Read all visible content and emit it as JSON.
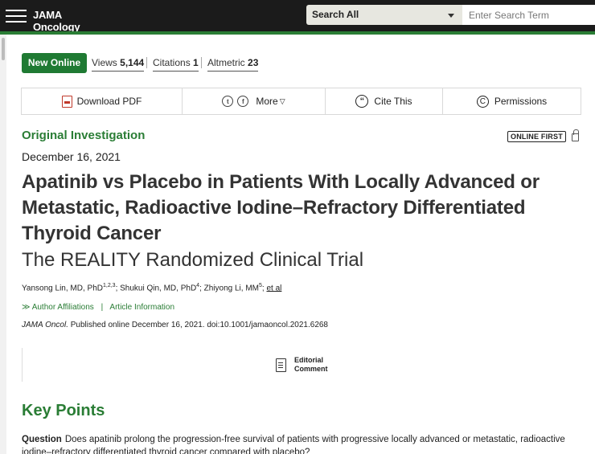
{
  "header": {
    "brand": "JAMA Oncology",
    "search_scope": "Search All",
    "search_placeholder": "Enter Search Term"
  },
  "metrics": {
    "badge": "New Online",
    "views_label": "Views",
    "views_value": "5,144",
    "citations_label": "Citations",
    "citations_value": "1",
    "altmetric_label": "Altmetric",
    "altmetric_value": "23"
  },
  "actions": {
    "download_pdf": "Download PDF",
    "more": "More",
    "cite": "Cite This",
    "permissions": "Permissions"
  },
  "article": {
    "type": "Original Investigation",
    "online_first": "ONLINE FIRST",
    "date": "December 16, 2021",
    "title": "Apatinib vs Placebo in Patients With Locally Advanced or Metastatic, Radioactive Iodine–Refractory Differentiated Thyroid Cancer",
    "subtitle": "The REALITY Randomized Clinical Trial",
    "authors": [
      {
        "name": "Yansong Lin, MD, PhD",
        "affil": "1,2,3"
      },
      {
        "name": "Shukui Qin, MD, PhD",
        "affil": "4"
      },
      {
        "name": "Zhiyong Li, MM",
        "affil": "5"
      }
    ],
    "et_al": "et al",
    "author_affiliations": "Author Affiliations",
    "article_information": "Article Information",
    "journal_abbrev": "JAMA Oncol.",
    "citation_rest": " Published online December 16, 2021. doi:10.1001/jamaoncol.2021.6268",
    "editorial_line1": "Editorial",
    "editorial_line2": "Comment"
  },
  "key_points": {
    "heading": "Key Points",
    "question_label": "Question",
    "question_text": "Does apatinib prolong the progression-free survival of patients with progressive locally advanced or metastatic, radioactive iodine–refractory differentiated thyroid cancer compared with placebo?"
  },
  "colors": {
    "brand_green": "#2a7d35",
    "topbar": "#1b1b1b"
  }
}
